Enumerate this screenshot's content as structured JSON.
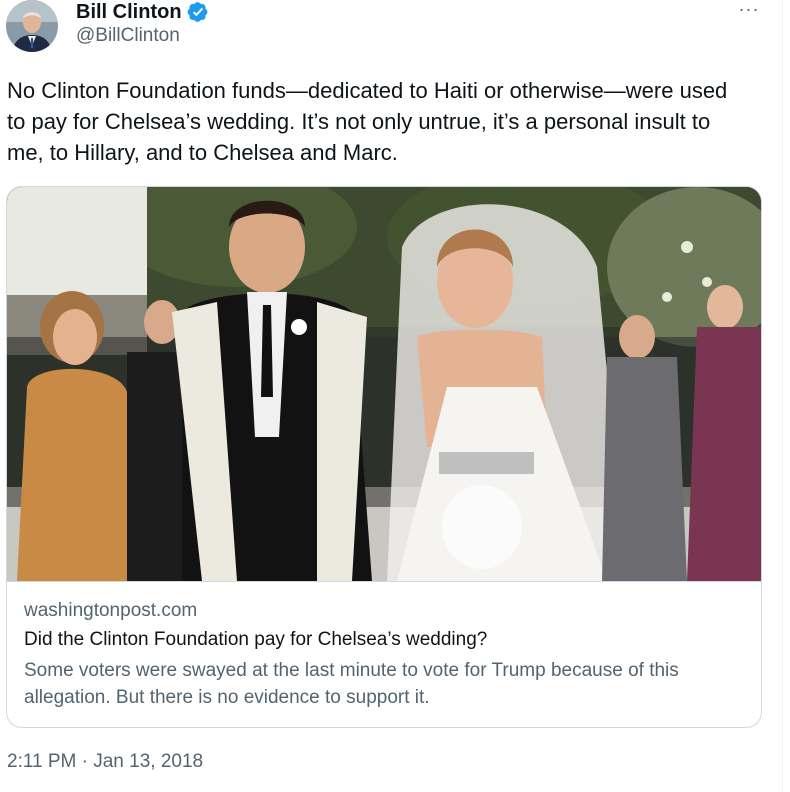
{
  "author": {
    "display_name": "Bill Clinton",
    "handle": "@BillClinton",
    "verified": true,
    "verified_color": "#1d9bf0"
  },
  "menu": {
    "more_label": "···",
    "more_icon": "ellipsis-icon"
  },
  "tweet": {
    "text": "No Clinton Foundation funds—dedicated to Haiti or otherwise—were used to pay for Chelsea’s wedding. It’s not only untrue, it’s a personal insult to me, to Hillary, and to Chelsea and Marc.",
    "timestamp": "2:11 PM · Jan 13, 2018"
  },
  "link_card": {
    "domain": "washingtonpost.com",
    "title": "Did the Clinton Foundation pay for Chelsea’s wedding?",
    "description": "Some voters were swayed at the last minute to vote for Trump because of this allegation. But there is no evidence to support it."
  },
  "colors": {
    "text_primary": "#0f1419",
    "text_secondary": "#536471",
    "border": "#cfd9de",
    "accent": "#1d9bf0"
  }
}
